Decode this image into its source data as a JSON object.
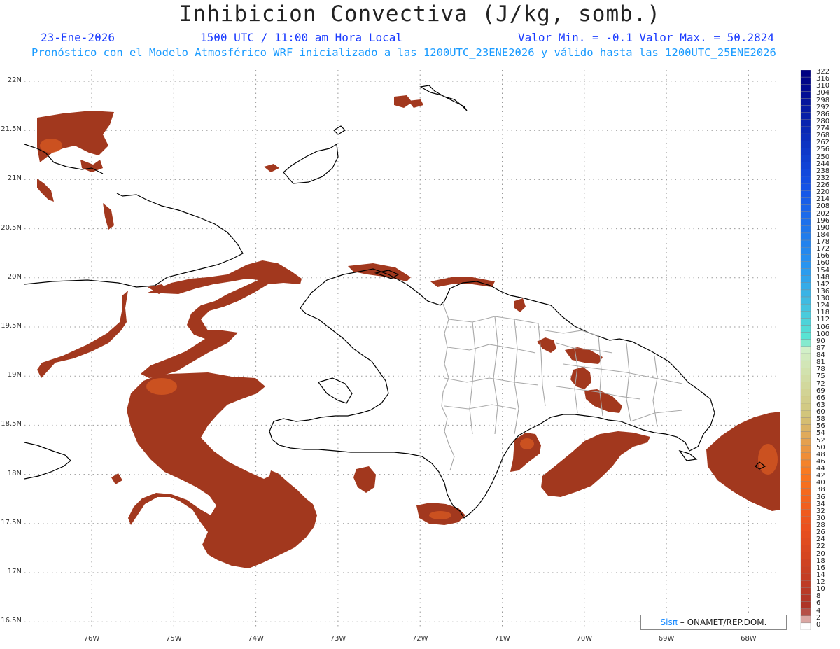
{
  "header": {
    "title": "Inhibicion Convectiva (J/kg, somb.)",
    "date": "23-Ene-2026",
    "time": "1500 UTC / 11:00 am Hora Local",
    "minmax": "Valor Min. = -0.1  Valor Max. = 50.2824",
    "forecast": "Pronóstico con el Modelo Atmosférico WRF inicializado a las 1200UTC_23ENE2026 y válido hasta las  1200UTC_25ENE2026"
  },
  "map": {
    "lat_labels": [
      "22N",
      "21.5N",
      "21N",
      "20.5N",
      "20N",
      "19.5N",
      "19N",
      "18.5N",
      "18N",
      "17.5N",
      "17N",
      "16.5N"
    ],
    "lon_labels": [
      "76W",
      "75W",
      "74W",
      "73W",
      "72W",
      "71W",
      "70W",
      "69W",
      "68W"
    ],
    "fill_color": "#a2381e",
    "fill_highlight": "#d85a22",
    "coast_color": "#000000",
    "border_color": "#a8a8a8"
  },
  "legend": {
    "labels": [
      "322",
      "316",
      "310",
      "304",
      "298",
      "292",
      "286",
      "280",
      "274",
      "268",
      "262",
      "256",
      "250",
      "244",
      "238",
      "232",
      "226",
      "220",
      "214",
      "208",
      "202",
      "196",
      "190",
      "184",
      "178",
      "172",
      "166",
      "160",
      "154",
      "148",
      "142",
      "136",
      "130",
      "124",
      "118",
      "112",
      "106",
      "100",
      "90",
      "87",
      "84",
      "81",
      "78",
      "75",
      "72",
      "69",
      "66",
      "63",
      "60",
      "58",
      "56",
      "54",
      "52",
      "50",
      "48",
      "46",
      "44",
      "42",
      "40",
      "38",
      "36",
      "34",
      "32",
      "30",
      "28",
      "26",
      "24",
      "22",
      "20",
      "18",
      "16",
      "14",
      "12",
      "10",
      "8",
      "6",
      "4",
      "2",
      "0"
    ]
  },
  "credit": {
    "sis": "Sisπ",
    "text": "– ONAMET/REP.DOM."
  }
}
